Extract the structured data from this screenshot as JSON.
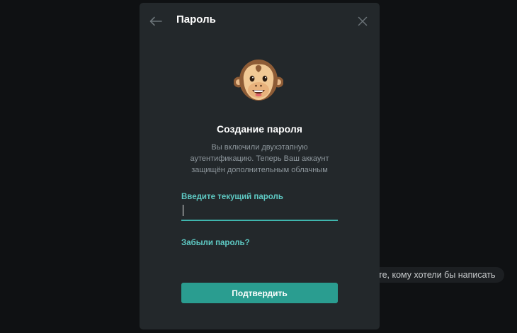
{
  "dialog": {
    "title": "Пароль",
    "heading": "Создание пароля",
    "description_lines": [
      "Вы включили двухэтапную",
      "аутентификацию. Теперь Ваш аккаунт",
      "защищён дополнительным облачным"
    ],
    "field_label": "Введите текущий пароль",
    "password_value": "",
    "forgot_link": "Забыли пароль?",
    "submit_label": "Подтвердить",
    "icons": {
      "back": "arrow-left-icon",
      "close": "close-icon",
      "illustration": "monkey-emoji"
    }
  },
  "background": {
    "hint_text": "те, кому хотели бы написать"
  },
  "colors": {
    "modal_bg": "#23282b",
    "accent": "#5ec9c3",
    "button": "#2a9d90"
  }
}
